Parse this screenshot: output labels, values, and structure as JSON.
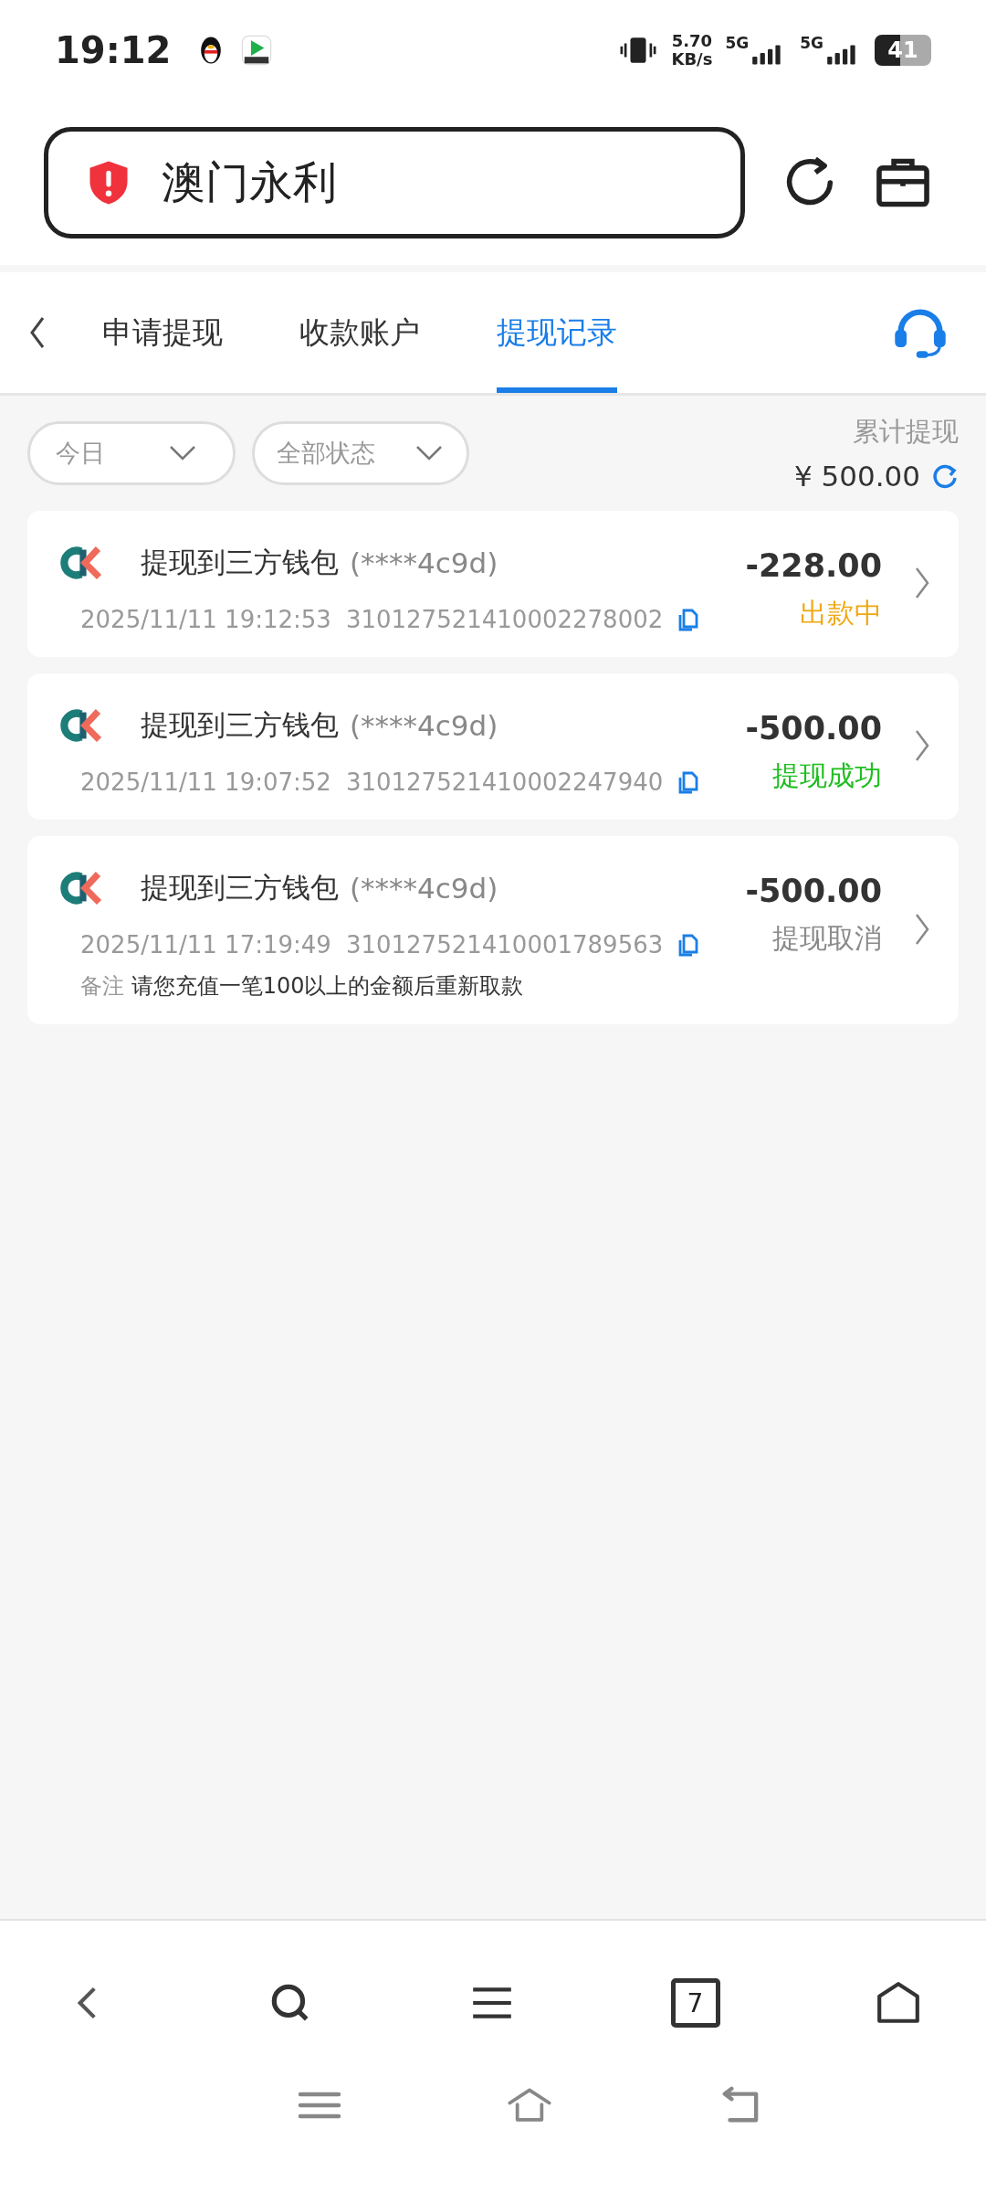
{
  "status_bar": {
    "time": "19:12",
    "speed": "5.70",
    "speed_unit": "KB/s",
    "networks": [
      "5G",
      "5G"
    ],
    "battery": "41"
  },
  "address_bar": {
    "title": "澳门永利"
  },
  "tabs": [
    {
      "label": "申请提现",
      "selected": false
    },
    {
      "label": "收款账户",
      "selected": false
    },
    {
      "label": "提现记录",
      "selected": true
    }
  ],
  "filters": [
    {
      "label": "今日"
    },
    {
      "label": "全部状态"
    }
  ],
  "total": {
    "label": "累计提现",
    "amount": "¥ 500.00"
  },
  "records": [
    {
      "title": "提现到三方钱包",
      "account": "(****4c9d)",
      "time": "2025/11/11 19:12:53",
      "order_no": "310127521410002278002",
      "amount": "-228.00",
      "status": "出款中",
      "color": "#f0a812"
    },
    {
      "title": "提现到三方钱包",
      "account": "(****4c9d)",
      "time": "2025/11/11 19:07:52",
      "order_no": "310127521410002247940",
      "amount": "-500.00",
      "status": "提现成功",
      "color": "#1fbe1f"
    },
    {
      "title": "提现到三方钱包",
      "account": "(****4c9d)",
      "time": "2025/11/11 17:19:49",
      "order_no": "310127521410001789563",
      "amount": "-500.00",
      "status": "提现取消",
      "color": "#8a8a8a",
      "note_label": "备注",
      "note": "请您充值一笔100以上的金额后重新取款"
    }
  ],
  "browser_bar": {
    "tab_count": "7"
  }
}
